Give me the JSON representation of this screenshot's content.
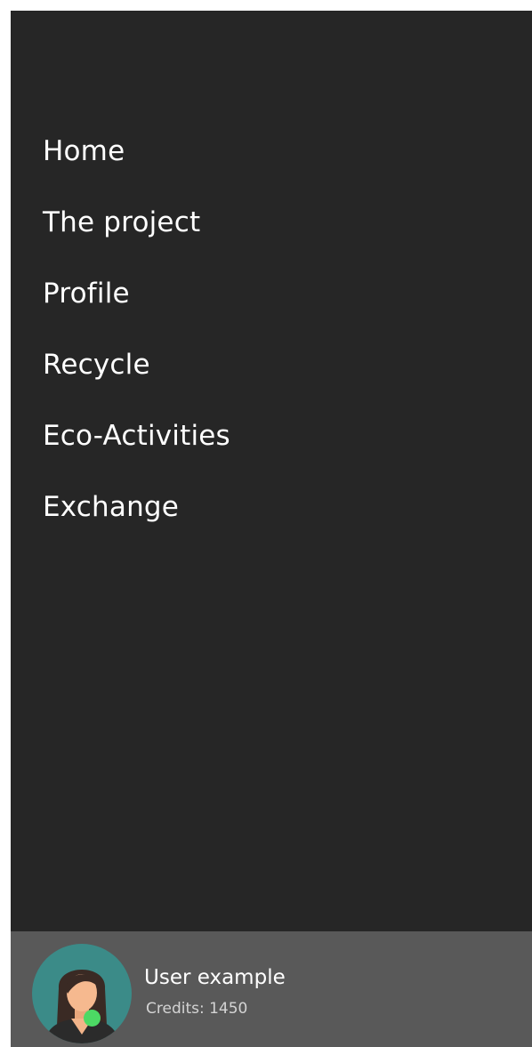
{
  "nav": {
    "items": [
      {
        "label": "Home"
      },
      {
        "label": "The project"
      },
      {
        "label": "Profile"
      },
      {
        "label": "Recycle"
      },
      {
        "label": "Eco-Activities"
      },
      {
        "label": "Exchange"
      }
    ]
  },
  "user": {
    "name": "User example",
    "credits": "Credits: 1450",
    "avatar_icon": "female-user-avatar",
    "status": "online",
    "status_color": "#4cd964"
  },
  "colors": {
    "drawer_bg": "#262626",
    "user_panel_bg": "#595959",
    "avatar_bg": "#3b8b88"
  }
}
